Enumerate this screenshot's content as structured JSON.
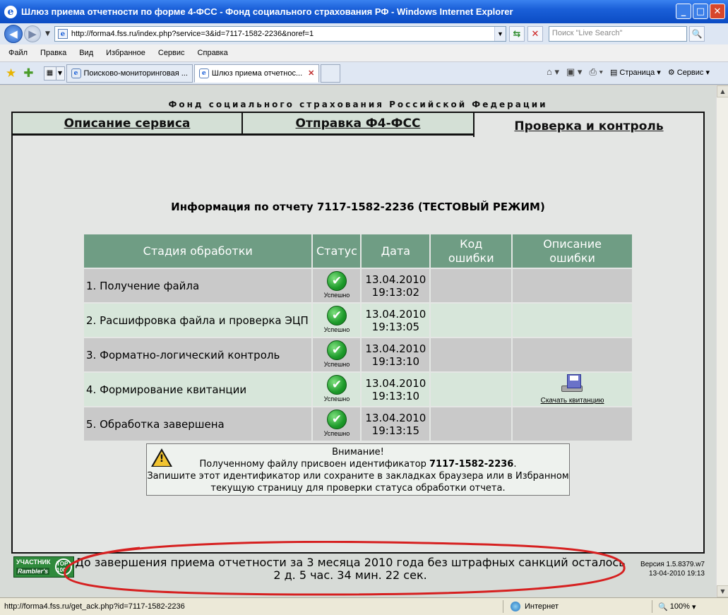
{
  "window": {
    "title": "Шлюз приема отчетности по форме 4-ФСС - Фонд социального страхования РФ - Windows Internet Explorer",
    "buttons": [
      "_",
      "□",
      "✕"
    ]
  },
  "address": {
    "url": "http://forma4.fss.ru/index.php?service=3&id=7117-1582-2236&noref=1",
    "search_placeholder": "Поиск \"Live Search\""
  },
  "menu": [
    "Файл",
    "Правка",
    "Вид",
    "Избранное",
    "Сервис",
    "Справка"
  ],
  "browser_tabs": [
    {
      "label": "Поисково-мониторинговая ..."
    },
    {
      "label": "Шлюз приема отчетнос..."
    }
  ],
  "toolbar": {
    "page": "Страница",
    "service": "Сервис"
  },
  "site": {
    "org": "Фонд социального страхования Российской Федерации",
    "tabs": [
      "Описание сервиса",
      "Отправка Ф4-ФСС",
      "Проверка и контроль"
    ],
    "heading": "Информация по отчету 7117-1582-2236 (ТЕСТОВЫЙ РЕЖИМ)",
    "table": {
      "headers": [
        "Стадия обработки",
        "Статус",
        "Дата",
        "Код ошибки",
        "Описание ошибки"
      ],
      "rows": [
        {
          "stage": "1. Получение файла",
          "status": "Успешно",
          "date": "13.04.2010",
          "time": "19:13:02",
          "code": "",
          "desc": ""
        },
        {
          "stage": "2. Расшифровка файла и проверка ЭЦП",
          "status": "Успешно",
          "date": "13.04.2010",
          "time": "19:13:05",
          "code": "",
          "desc": ""
        },
        {
          "stage": "3. Форматно-логический контроль",
          "status": "Успешно",
          "date": "13.04.2010",
          "time": "19:13:10",
          "code": "",
          "desc": ""
        },
        {
          "stage": "4. Формирование квитанции",
          "status": "Успешно",
          "date": "13.04.2010",
          "time": "19:13:10",
          "code": "",
          "desc": "Скачать квитанцию"
        },
        {
          "stage": "5. Обработка завершена",
          "status": "Успешно",
          "date": "13.04.2010",
          "time": "19:13:15",
          "code": "",
          "desc": ""
        }
      ]
    },
    "notice": {
      "title": "Внимание!",
      "line1": "Полученному файлу присвоен идентификатор",
      "id": "7117-1582-2236",
      "line2": "Запишите этот идентификатор или сохраните в закладках браузера или в Избранном",
      "line3": "текущую страницу для проверки статуса обработки отчета."
    },
    "footer": {
      "rambler_line1": "УЧАСТНИК",
      "rambler_line2": "Rambler's",
      "rambler_top": "TOP 100",
      "deadline_line1": "До завершения приема отчетности за 3 месяца 2010 года без штрафных санкций осталось",
      "deadline_line2": "2 д. 5 час. 34 мин. 22 сек.",
      "version": "Версия 1.5.8379.w7",
      "version_date": "13-04-2010 19:13"
    }
  },
  "statusbar": {
    "url": "http://forma4.fss.ru/get_ack.php?id=7117-1582-2236",
    "zone": "Интернет",
    "zoom": "100%"
  },
  "colors": {
    "table_header": "#6f9d84",
    "row_odd": "#c9c9c9",
    "row_even": "#d7e6da",
    "annotation": "#d62020"
  }
}
